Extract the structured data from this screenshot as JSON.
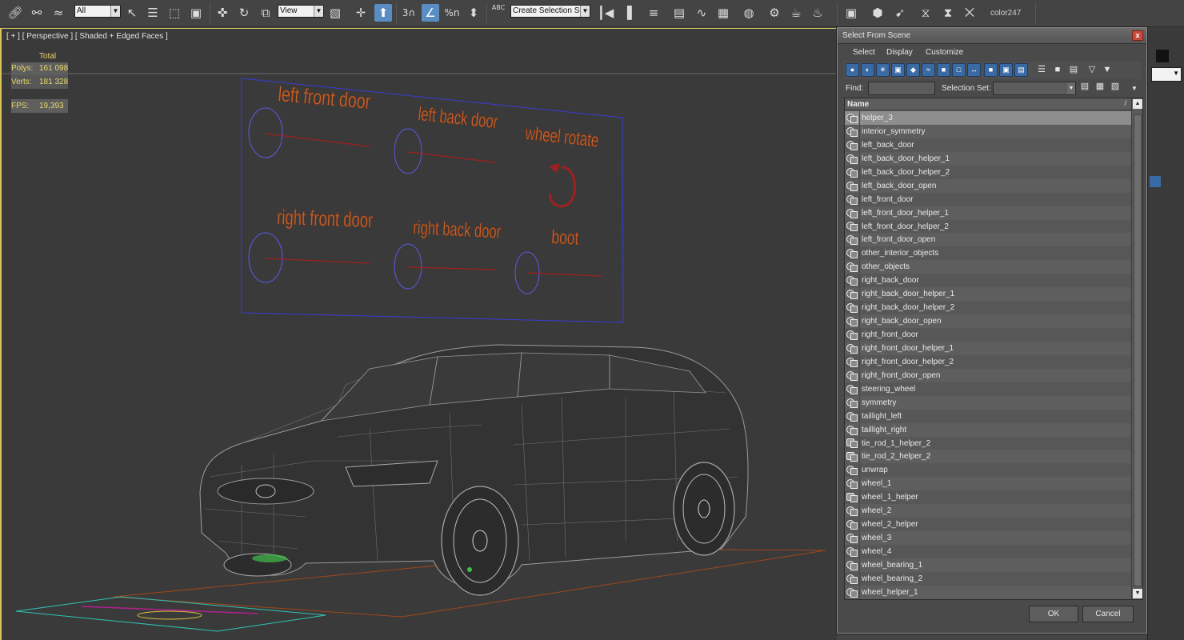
{
  "toolbar": {
    "selection_filter": "All",
    "ref_coord": "View",
    "named_selection_placeholder": "Create Selection Se",
    "layer_label": "color247",
    "snap_value": "3",
    "percent_snap": "%",
    "angle_snap": "n",
    "text_icon": "ABC",
    "accent_color": "#5a8ec2"
  },
  "viewport": {
    "label": "[ + ] [ Perspective ] [ Shaded + Edged Faces ]",
    "stats_header": "Total",
    "stats": [
      {
        "key": "Polys:",
        "value": "161 098"
      },
      {
        "key": "Verts:",
        "value": "181 328"
      },
      {
        "key": "FPS:",
        "value": "19,393"
      }
    ],
    "panel_labels": {
      "left_front_door": "left front door",
      "left_back_door": "left back door",
      "wheel_rotate": "wheel rotate",
      "right_front_door": "right front door",
      "right_back_door": "right back door",
      "boot": "boot"
    },
    "label_color": "#c8622a",
    "frame_color": "#d6c35a"
  },
  "dialog": {
    "title": "Select From Scene",
    "close_glyph": "x",
    "menu": [
      "Select",
      "Display",
      "Customize"
    ],
    "find_label": "Find:",
    "selection_set_label": "Selection Set:",
    "column_header": "Name",
    "sort_glyph": "/",
    "ok_label": "OK",
    "cancel_label": "Cancel",
    "items": [
      "helper_3",
      "interior_symmetry",
      "left_back_door",
      "left_back_door_helper_1",
      "left_back_door_helper_2",
      "left_back_door_open",
      "left_front_door",
      "left_front_door_helper_1",
      "left_front_door_helper_2",
      "left_front_door_open",
      "other_interior_objects",
      "other_objects",
      "right_back_door",
      "right_back_door_helper_1",
      "right_back_door_helper_2",
      "right_back_door_open",
      "right_front_door",
      "right_front_door_helper_1",
      "right_front_door_helper_2",
      "right_front_door_open",
      "steering_wheel",
      "symmetry",
      "taillight_left",
      "taillight_right",
      "tie_rod_1_helper_2",
      "tie_rod_2_helper_2",
      "unwrap",
      "wheel_1",
      "wheel_1_helper",
      "wheel_2",
      "wheel_2_helper",
      "wheel_3",
      "wheel_4",
      "wheel_bearing_1",
      "wheel_bearing_2",
      "wheel_helper_1"
    ],
    "selected_item": "helper_3"
  }
}
